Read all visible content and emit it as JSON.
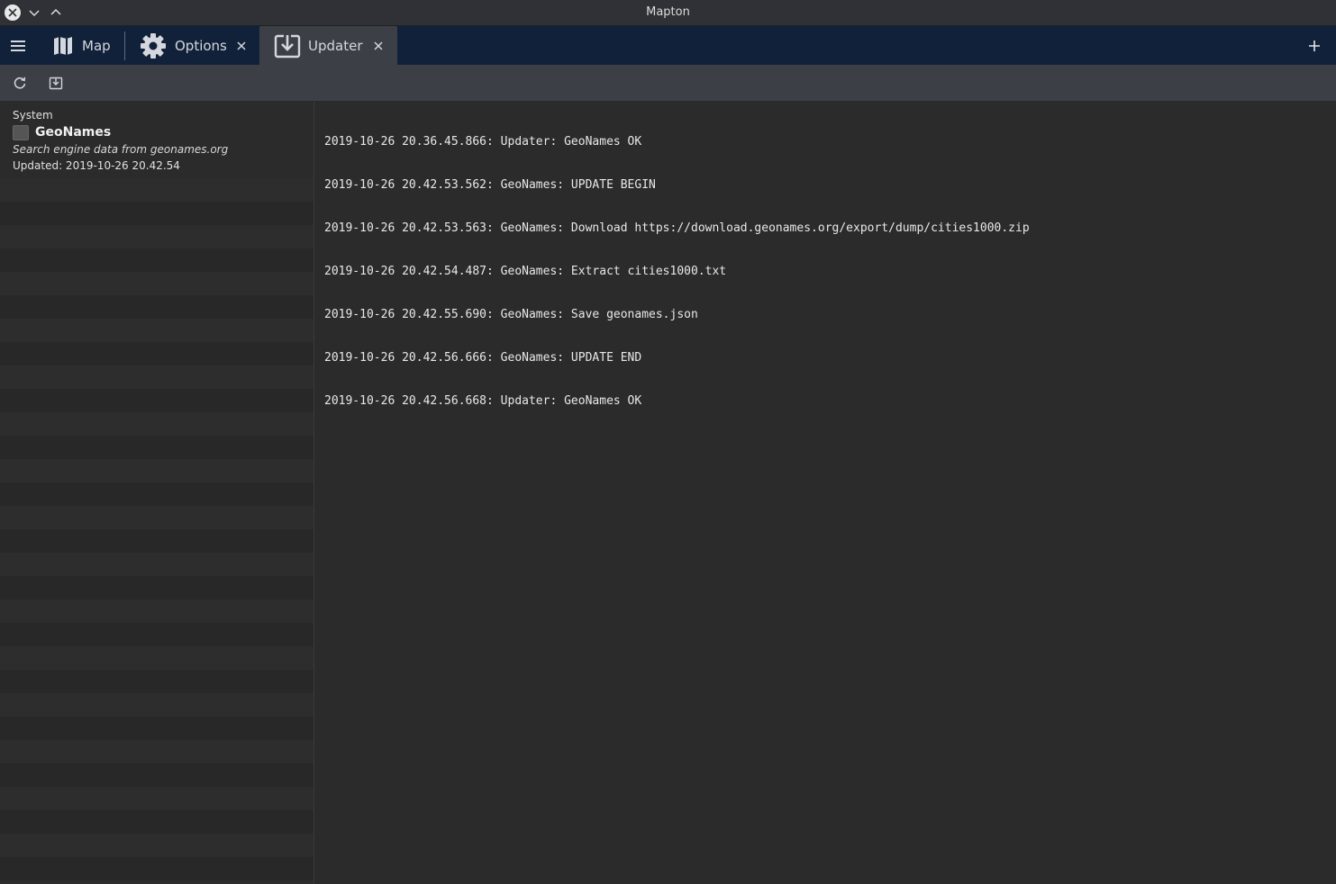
{
  "window": {
    "title": "Mapton"
  },
  "tabs": [
    {
      "label": "Map",
      "icon": "map-icon"
    },
    {
      "label": "Options",
      "icon": "gear-icon"
    },
    {
      "label": "Updater",
      "icon": "download-icon"
    }
  ],
  "toolbar": {
    "refresh_icon": "refresh-icon",
    "update_icon": "download-icon"
  },
  "items": [
    {
      "category": "System",
      "title": "GeoNames",
      "description": "Search engine data from geonames.org",
      "updated": "Updated: 2019-10-26 20.42.54",
      "checked": false
    }
  ],
  "log": [
    "2019-10-26 20.36.45.866: Updater: GeoNames OK",
    "2019-10-26 20.42.53.562: GeoNames: UPDATE BEGIN",
    "2019-10-26 20.42.53.563: GeoNames: Download https://download.geonames.org/export/dump/cities1000.zip",
    "2019-10-26 20.42.54.487: GeoNames: Extract cities1000.txt",
    "2019-10-26 20.42.55.690: GeoNames: Save geonames.json",
    "2019-10-26 20.42.56.666: GeoNames: UPDATE END",
    "2019-10-26 20.42.56.668: Updater: GeoNames OK"
  ]
}
